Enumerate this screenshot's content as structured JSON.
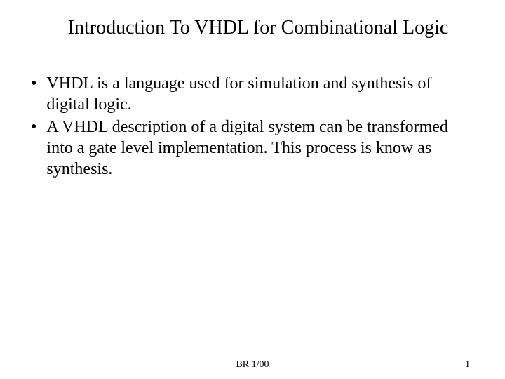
{
  "slide": {
    "title": "Introduction To VHDL for Combinational Logic",
    "bullets": [
      "VHDL is a language used for simulation and synthesis of digital logic.",
      "A VHDL description of a digital system can be transformed into a gate level implementation. This process is know as synthesis."
    ],
    "footer_center": "BR 1/00",
    "footer_right": "1"
  }
}
